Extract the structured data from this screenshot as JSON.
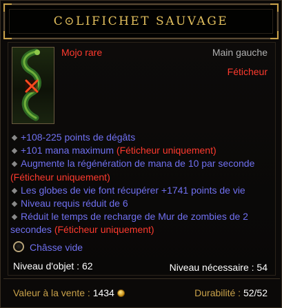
{
  "item": {
    "name": "C⊙LIFICHET SAUVAGE",
    "type": "Mojo rare",
    "slot": "Main gauche",
    "class_restriction": "Féticheur"
  },
  "affixes": [
    {
      "text": "+108-225 points de dégâts",
      "restriction": ""
    },
    {
      "text": "+101 mana maximum",
      "restriction": "(Féticheur uniquement)"
    },
    {
      "text": "Augmente la régénération de mana de 10 par seconde",
      "restriction": "(Féticheur uniquement)"
    },
    {
      "text": "Les globes de vie font récupérer +1741 points de vie",
      "restriction": ""
    },
    {
      "text": "Niveau requis réduit de 6",
      "restriction": ""
    },
    {
      "text": "Réduit le temps de recharge de Mur de zombies de 2 secondes",
      "restriction": "(Féticheur uniquement)"
    }
  ],
  "socket": {
    "label": "Châsse vide"
  },
  "stats": {
    "item_level": "Niveau d'objet : 62",
    "required_level": "Niveau nécessaire : 54"
  },
  "footer": {
    "sell_label": "Valeur à la vente :",
    "sell_value": "1434",
    "durability_label": "Durabilité :",
    "durability_value": "52/52"
  },
  "colors": {
    "title_gold": "#e3c05e",
    "rare_red": "#ff3a2e",
    "affix_blue": "#7070f0",
    "frame_gold": "#c9a24a"
  }
}
